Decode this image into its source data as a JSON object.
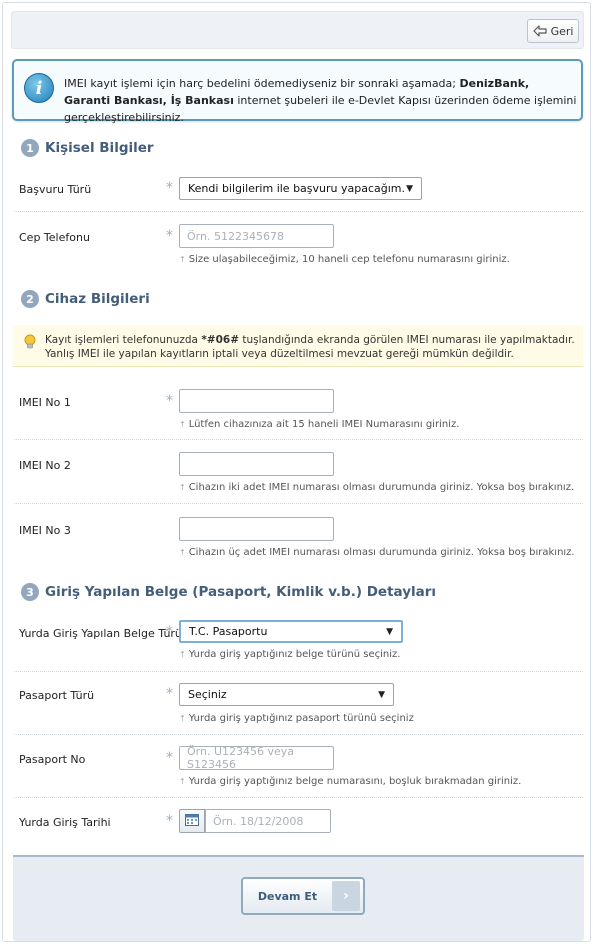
{
  "header": {
    "back_label": "Geri"
  },
  "info": {
    "t1": "IMEI kayıt işlemi için harç bedelini ödemediyseniz bir sonraki aşamada; ",
    "b1": "DenizBank, Garanti Bankası, İş Bankası",
    "t2": " internet şubeleri ile e-Devlet Kapısı üzerinden ödeme işlemini gerçekleştirebilirsiniz."
  },
  "sections": [
    {
      "num": "1",
      "title": "Kişisel Bilgiler"
    },
    {
      "num": "2",
      "title": "Cihaz Bilgileri"
    },
    {
      "num": "3",
      "title": "Giriş Yapılan Belge (Pasaport, Kimlik v.b.) Detayları"
    }
  ],
  "required_mark": "*",
  "personal": {
    "basvuru_label": "Başvuru Türü",
    "basvuru_value": "Kendi bilgilerim ile başvuru yapacağım.",
    "phone_label": "Cep Telefonu",
    "phone_placeholder": "Örn. 5122345678",
    "phone_hint": "Size ulaşabileceğimiz, 10 haneli cep telefonu numarasını giriniz."
  },
  "warning": {
    "t1": "Kayıt işlemleri telefonunuzda ",
    "code": "*#06#",
    "t2": " tuşlandığında ekranda görülen IMEI numarası ile yapılmaktadır. Yanlış IMEI ile yapılan kayıtların iptali veya düzeltilmesi mevzuat gereği mümkün değildir."
  },
  "device": {
    "imei1_label": "IMEI No 1",
    "imei1_hint": "Lütfen cihazınıza ait 15 haneli IMEI Numarasını giriniz.",
    "imei2_label": "IMEI No 2",
    "imei2_hint": "Cihazın iki adet IMEI numarası olması durumunda giriniz. Yoksa boş bırakınız.",
    "imei3_label": "IMEI No 3",
    "imei3_hint": "Cihazın üç adet IMEI numarası olması durumunda giriniz. Yoksa boş bırakınız."
  },
  "document": {
    "type_label": "Yurda Giriş Yapılan Belge Türü",
    "type_value": "T.C. Pasaportu",
    "type_hint": "Yurda giriş yaptığınız belge türünü seçiniz.",
    "pass_type_label": "Pasaport Türü",
    "pass_type_value": "Seçiniz",
    "pass_type_hint": "Yurda giriş yaptığınız pasaport türünü seçiniz",
    "pass_no_label": "Pasaport No",
    "pass_no_placeholder": "Örn. U123456 veya S123456",
    "pass_no_hint": "Yurda giriş yaptığınız belge numarasını, boşluk bırakmadan giriniz.",
    "date_label": "Yurda Giriş Tarihi",
    "date_placeholder": "Örn. 18/12/2008"
  },
  "footer": {
    "continue_label": "Devam Et"
  }
}
